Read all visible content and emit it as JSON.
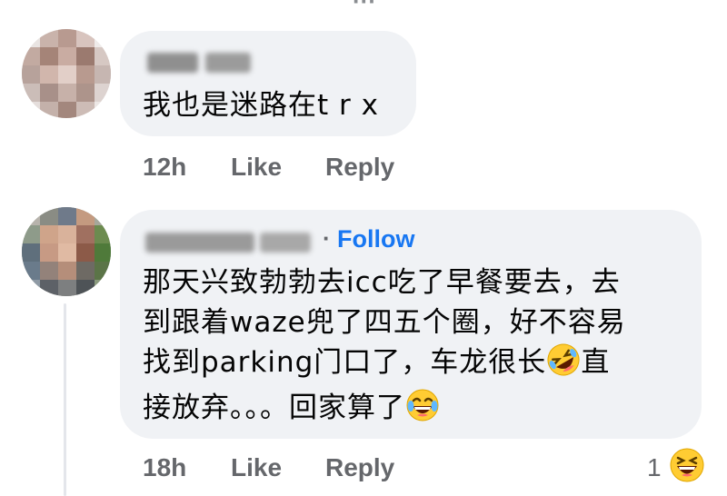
{
  "comments": [
    {
      "author": "",
      "text_lines": [
        "我也是迷路在t r x"
      ],
      "time": "12h",
      "like_label": "Like",
      "reply_label": "Reply"
    },
    {
      "author": "",
      "follow_separator": "·",
      "follow_label": "Follow",
      "text_lines": [
        "那天兴致勃勃去icc吃了早餐要去，去",
        "到跟着waze兜了四五个圈，好不容易",
        "找到parking门口了，车龙很长",
        "直",
        "接放弃。。。回家算了"
      ],
      "time": "18h",
      "like_label": "Like",
      "reply_label": "Reply",
      "reaction_count": "1"
    }
  ],
  "icons": {
    "rolling_laughing": "rolling-on-floor-laughing-emoji",
    "tears_of_joy": "face-with-tears-of-joy-emoji",
    "squinting_laugh": "grinning-squinting-face-emoji"
  },
  "colors": {
    "bubble": "#f0f2f5",
    "link": "#1877f2",
    "meta": "#65676b",
    "text": "#050505"
  }
}
